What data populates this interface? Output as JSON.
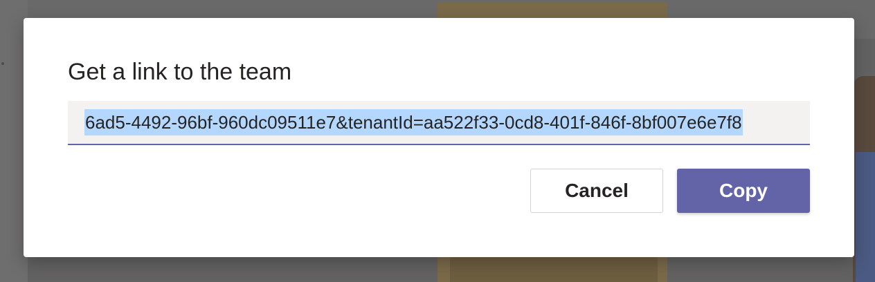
{
  "dialog": {
    "title": "Get a link to the team",
    "link_value": "6ad5-4492-96bf-960dc09511e7&tenantId=aa522f33-0cd8-401f-846f-8bf007e6e7f8",
    "cancel_label": "Cancel",
    "copy_label": "Copy"
  },
  "colors": {
    "accent": "#6264a7",
    "selection": "#b3d7fe",
    "field_background": "#f3f2f1"
  }
}
